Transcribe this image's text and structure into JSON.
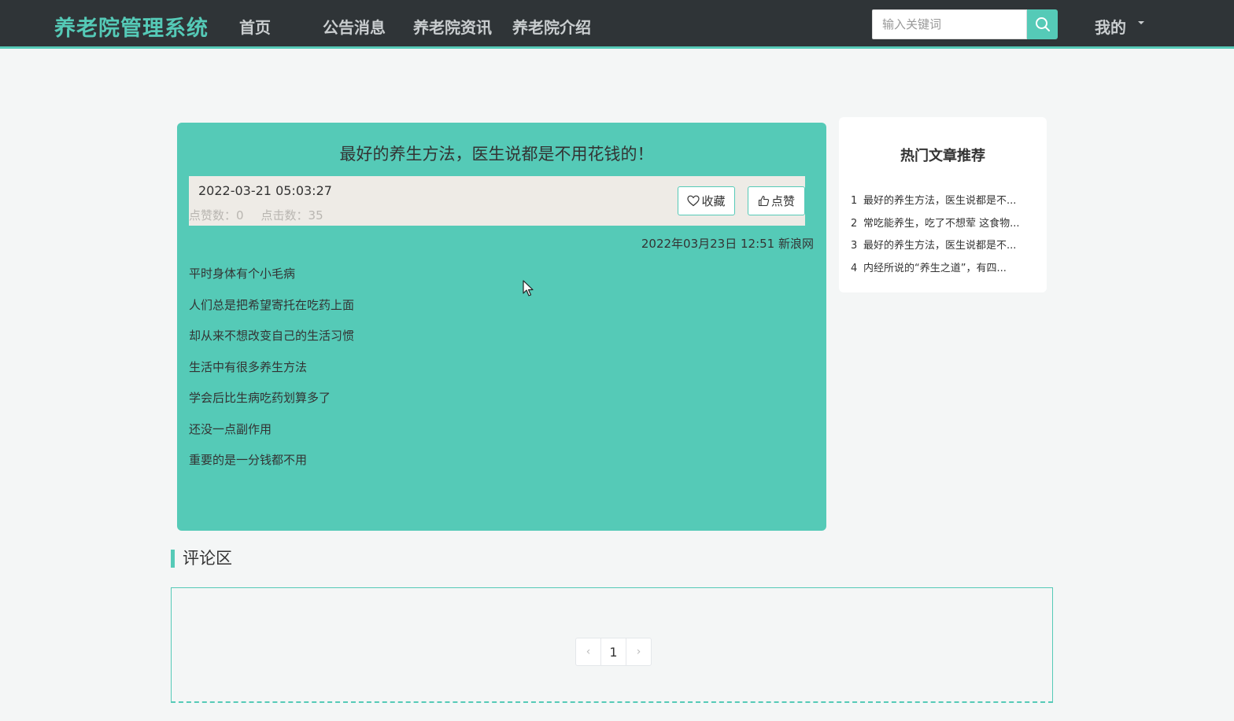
{
  "header": {
    "brand": "养老院管理系统",
    "nav": [
      "首页",
      "公告消息",
      "养老院资讯",
      "养老院介绍"
    ],
    "search_placeholder": "输入关键词",
    "search_icon": "search-icon",
    "mine_label": "我的"
  },
  "article": {
    "title": "最好的养生方法，医生说都是不用花钱的！",
    "datetime": "2022-03-21 05:03:27",
    "likes_label": "点赞数：0",
    "clicks_label": "点击数：35",
    "collect_label": "收藏",
    "like_label": "点赞",
    "source": "2022年03月23日 12:51 新浪网",
    "body": [
      "平时身体有个小毛病",
      "人们总是把希望寄托在吃药上面",
      "却从来不想改变自己的生活习惯",
      "生活中有很多养生方法",
      "学会后比生病吃药划算多了",
      "还没一点副作用",
      "重要的是一分钱都不用"
    ]
  },
  "hot": {
    "title": "热门文章推荐",
    "items": [
      {
        "num": "1",
        "text": "最好的养生方法，医生说都是不..."
      },
      {
        "num": "2",
        "text": "常吃能养生，吃了不想荤 这食物..."
      },
      {
        "num": "3",
        "text": "最好的养生方法，医生说都是不..."
      },
      {
        "num": "4",
        "text": "内经所说的“养生之道”，有四..."
      }
    ]
  },
  "comments": {
    "title": "评论区",
    "pager": {
      "prev": "‹",
      "page": "1",
      "next": "›"
    }
  },
  "colors": {
    "accent": "#55cab7",
    "topbar": "#2f3437",
    "background": "#f4f6f6"
  }
}
